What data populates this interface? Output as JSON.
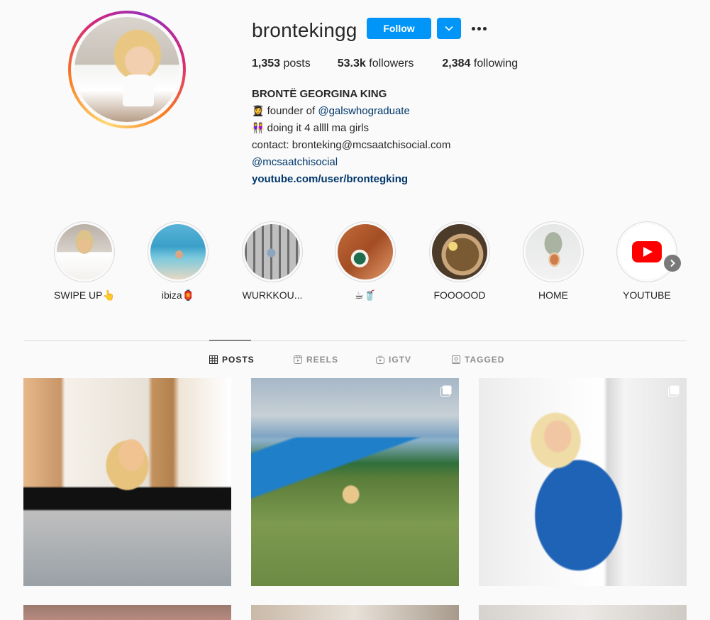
{
  "profile": {
    "username": "brontekingg",
    "follow_label": "Follow",
    "stats": {
      "posts_value": "1,353",
      "posts_label": "posts",
      "followers_value": "53.3k",
      "followers_label": "followers",
      "following_value": "2,384",
      "following_label": "following"
    },
    "bio": {
      "full_name": "BRONTË GEORGINA KING",
      "line1_emoji": "👩‍🎓",
      "line1_prefix": "founder of",
      "line1_link": "@galswhograduate",
      "line2_emoji": "👭",
      "line2_text": "doing it 4 allll ma girls",
      "line3": "contact: bronteking@mcsaatchisocial.com",
      "line4_link": "@mcsaatchisocial",
      "website": "youtube.com/user/brontegking"
    }
  },
  "highlights": [
    {
      "label": "SWIPE UP👆"
    },
    {
      "label": "ibiza🏮"
    },
    {
      "label": "WURKKOU..."
    },
    {
      "label": "☕🥤"
    },
    {
      "label": "FOOOOOD"
    },
    {
      "label": "HOME"
    },
    {
      "label": "YOUTUBE"
    }
  ],
  "tabs": [
    {
      "label": "POSTS",
      "icon": "grid-icon"
    },
    {
      "label": "REELS",
      "icon": "reels-icon"
    },
    {
      "label": "IGTV",
      "icon": "igtv-icon"
    },
    {
      "label": "TAGGED",
      "icon": "tagged-icon"
    }
  ],
  "colors": {
    "accent": "#0095f6",
    "link": "#00376b",
    "text": "#262626",
    "muted": "#8e8e8e",
    "background": "#fafafa"
  }
}
